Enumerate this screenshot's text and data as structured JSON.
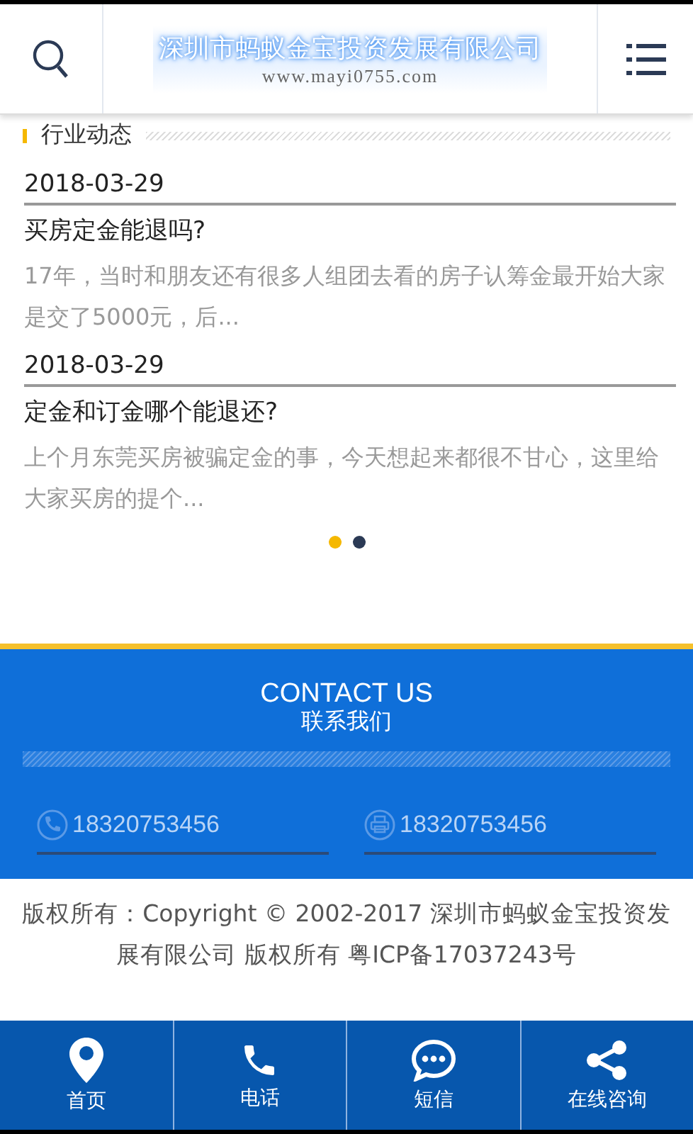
{
  "header": {
    "company_name": "深圳市蚂蚁金宝投资发展有限公司",
    "website": "www.mayi0755.com"
  },
  "section": {
    "title": "行业动态"
  },
  "articles": [
    {
      "date": "2018-03-29",
      "title": "买房定金能退吗?",
      "summary": "17年，当时和朋友还有很多人组团去看的房子认筹金最开始大家是交了5000元，后..."
    },
    {
      "date": "2018-03-29",
      "title": "定金和订金哪个能退还?",
      "summary": "上个月东莞买房被骗定金的事，今天想起来都很不甘心，这里给大家买房的提个..."
    }
  ],
  "carousel_dots": [
    {
      "selected": true
    },
    {
      "selected": false
    }
  ],
  "contact": {
    "title": "CONTACT US",
    "subtitle": "联系我们",
    "items": [
      {
        "kind": "phone",
        "value": "18320753456"
      },
      {
        "kind": "fax",
        "value": "18320753456"
      }
    ]
  },
  "copyright": "版权所有：Copyright © 2002-2017 深圳市蚂蚁金宝投资发展有限公司 版权所有 粤ICP备17037243号",
  "nav": [
    {
      "kind": "home",
      "label": "首页"
    },
    {
      "kind": "phone",
      "label": "电话"
    },
    {
      "kind": "sms",
      "label": "短信"
    },
    {
      "kind": "share",
      "label": "在线咨询"
    }
  ]
}
